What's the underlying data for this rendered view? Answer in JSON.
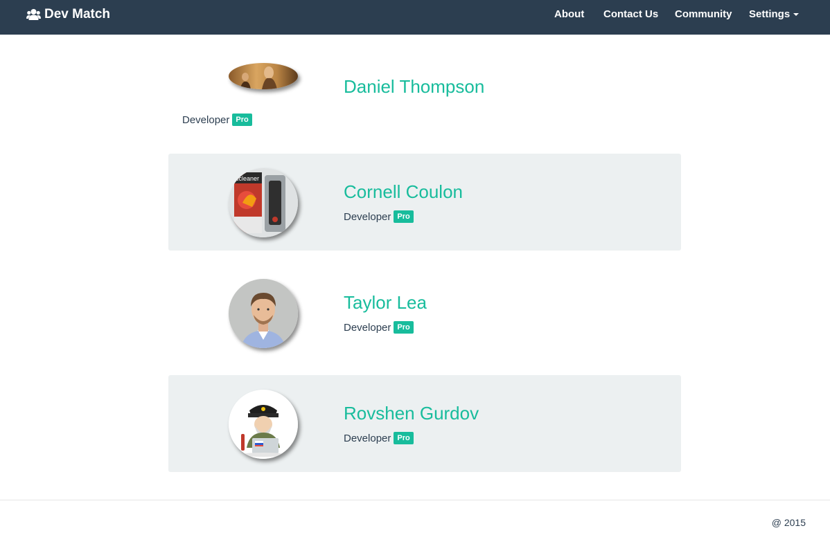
{
  "navbar": {
    "brand_label": "Dev Match",
    "brand_icon": "users-icon",
    "links": [
      {
        "label": "About"
      },
      {
        "label": "Contact Us"
      },
      {
        "label": "Community"
      },
      {
        "label": "Settings",
        "has_dropdown": true
      }
    ]
  },
  "profiles": [
    {
      "name": "Daniel Thompson",
      "role": "Developer",
      "badge": "Pro",
      "avatar": "daniel-photo",
      "shaded": false
    },
    {
      "name": "Cornell Coulon",
      "role": "Developer",
      "badge": "Pro",
      "avatar": "ccleaner-photo",
      "shaded": true
    },
    {
      "name": "Taylor Lea",
      "role": "Developer",
      "badge": "Pro",
      "avatar": "taylor-photo",
      "shaded": false
    },
    {
      "name": "Rovshen Gurdov",
      "role": "Developer",
      "badge": "Pro",
      "avatar": "cartoon-soldier-photo",
      "shaded": true
    }
  ],
  "footer": {
    "text": "@ 2015"
  },
  "colors": {
    "navbar_bg": "#2c3e50",
    "accent": "#18bc9c",
    "card_bg": "#ecf0f1",
    "text": "#2c3e50"
  }
}
